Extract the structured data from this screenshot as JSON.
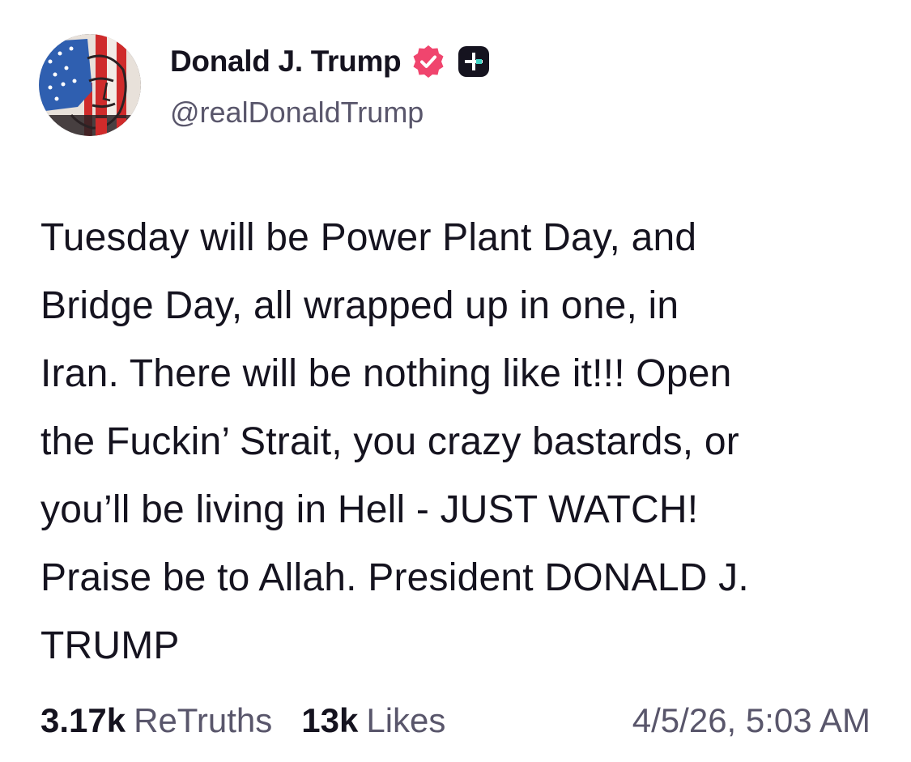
{
  "author": {
    "display_name": "Donald J. Trump",
    "handle": "@realDonaldTrump",
    "avatar_icon": "flag-face-avatar",
    "verified_icon": "verified-badge-icon",
    "plus_icon": "truth-plus-icon"
  },
  "post": {
    "lines": [
      "Tuesday will be Power Plant Day, and",
      "Bridge Day, all wrapped up in one, in",
      "Iran. There will be nothing like it!!! Open",
      "the Fuckin’ Strait, you crazy bastards, or",
      "you’ll be living in Hell - JUST WATCH!",
      "Praise be to Allah. President DONALD J.",
      "TRUMP"
    ]
  },
  "stats": {
    "retruths_count": "3.17k",
    "retruths_label": "ReTruths",
    "likes_count": "13k",
    "likes_label": "Likes",
    "timestamp": "4/5/26, 5:03 AM"
  },
  "colors": {
    "verified_badge": "#f0456e",
    "plus_badge": "#15131f",
    "muted_text": "#59566b",
    "body_text": "#15131f"
  }
}
